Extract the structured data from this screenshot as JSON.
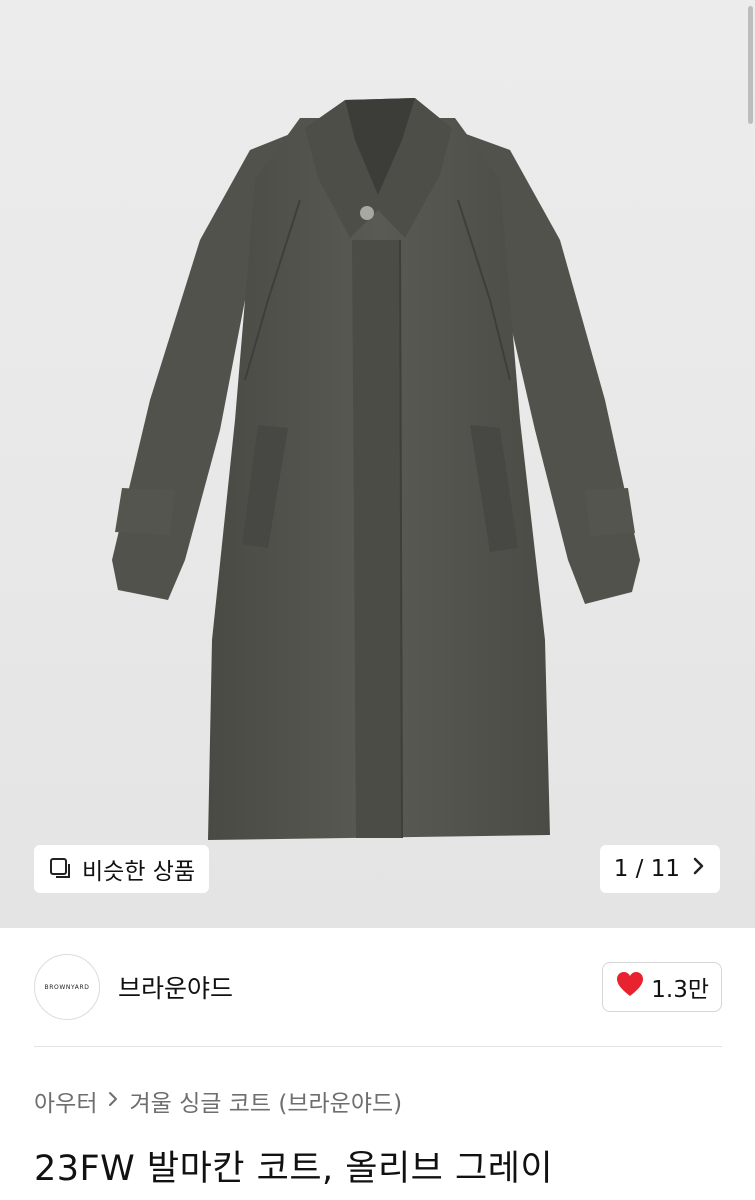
{
  "gallery": {
    "similar_label": "비슷한 상품",
    "similar_icon": "copy-icon",
    "pager_current": "1",
    "pager_separator": "/",
    "pager_total": "11",
    "pager_next_icon": "chevron-right-icon"
  },
  "shop": {
    "logo_text": "BROWNYARD",
    "name": "브라운야드",
    "like_icon": "heart-icon",
    "like_color": "#e8232f",
    "like_count": "1.3만"
  },
  "breadcrumb": {
    "category": "아우터",
    "subcategory": "겨울 싱글 코트 (브라운야드)"
  },
  "product": {
    "title": "23FW 발마칸 코트, 올리브 그레이"
  }
}
